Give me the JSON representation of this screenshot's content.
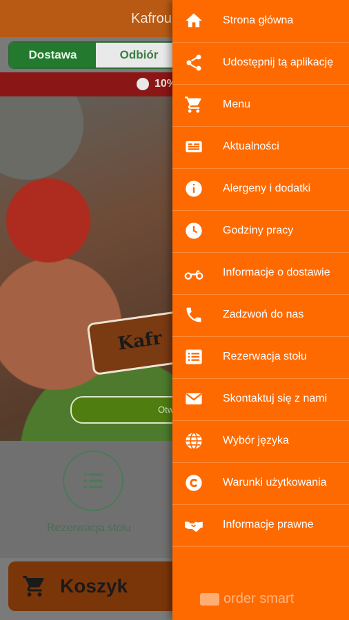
{
  "header": {
    "title": "Kafroun"
  },
  "order_mode": {
    "delivery_label": "Dostawa",
    "pickup_label": "Odbiór"
  },
  "promo": {
    "text": "10%"
  },
  "hero": {
    "logo_text": "Kafr",
    "open_button_label": "Otw"
  },
  "quick_actions": {
    "reservation_label": "Rezerwacja stołu"
  },
  "cart": {
    "label": "Koszyk"
  },
  "drawer": {
    "items": [
      {
        "label": "Strona główna",
        "icon": "home-icon"
      },
      {
        "label": "Udostępnij tą aplikację",
        "icon": "share-icon"
      },
      {
        "label": "Menu",
        "icon": "cart-icon"
      },
      {
        "label": "Aktualności",
        "icon": "news-icon"
      },
      {
        "label": "Alergeny i dodatki",
        "icon": "info-icon"
      },
      {
        "label": "Godziny pracy",
        "icon": "clock-icon"
      },
      {
        "label": "Informacje o dostawie",
        "icon": "motorcycle-icon"
      },
      {
        "label": "Zadzwoń do nas",
        "icon": "phone-icon"
      },
      {
        "label": "Rezerwacja stołu",
        "icon": "list-icon"
      },
      {
        "label": "Skontaktuj się z nami",
        "icon": "mail-icon"
      },
      {
        "label": "Wybór języka",
        "icon": "globe-icon"
      },
      {
        "label": "Warunki użytkowania",
        "icon": "copyright-icon"
      },
      {
        "label": "Informacje prawne",
        "icon": "handshake-icon"
      }
    ],
    "brand": "order smart"
  },
  "colors": {
    "drawer": "#ff6a00",
    "accent_green": "#237a2f",
    "promo_red": "#8b1616"
  }
}
